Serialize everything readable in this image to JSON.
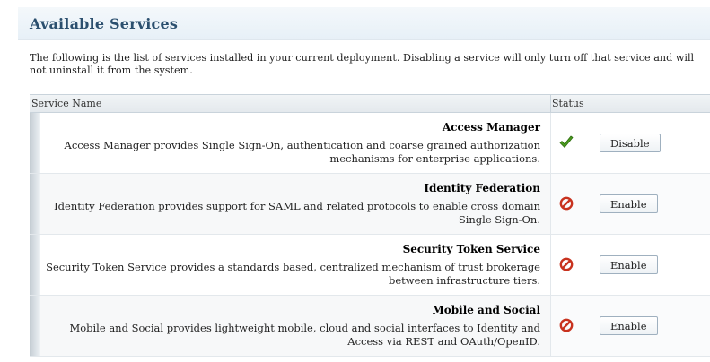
{
  "page": {
    "title": "Available Services",
    "intro": "The following is the list of services installed in your current deployment. Disabling a service will only turn off that service and will not uninstall it from the system."
  },
  "table": {
    "headers": {
      "name": "Service Name",
      "status": "Status"
    },
    "rows": [
      {
        "name": "Access Manager",
        "description": "Access Manager provides Single Sign-On, authentication and coarse grained authorization mechanisms for enterprise applications.",
        "status_icon": "check-icon",
        "status": "enabled",
        "action_label": "Disable"
      },
      {
        "name": "Identity Federation",
        "description": "Identity Federation provides support for SAML and related protocols to enable cross domain Single Sign-On.",
        "status_icon": "disabled-icon",
        "status": "disabled",
        "action_label": "Enable"
      },
      {
        "name": "Security Token Service",
        "description": "Security Token Service provides a standards based, centralized mechanism of trust brokerage between infrastructure tiers.",
        "status_icon": "disabled-icon",
        "status": "disabled",
        "action_label": "Enable"
      },
      {
        "name": "Mobile and Social",
        "description": "Mobile and Social provides lightweight mobile, cloud and social interfaces to Identity and Access via REST and OAuth/OpenID.",
        "status_icon": "disabled-icon",
        "status": "disabled",
        "action_label": "Enable"
      }
    ]
  },
  "colors": {
    "title": "#2b4f6e",
    "enabled": "#4a9a1e",
    "disabled": "#c8321e"
  }
}
